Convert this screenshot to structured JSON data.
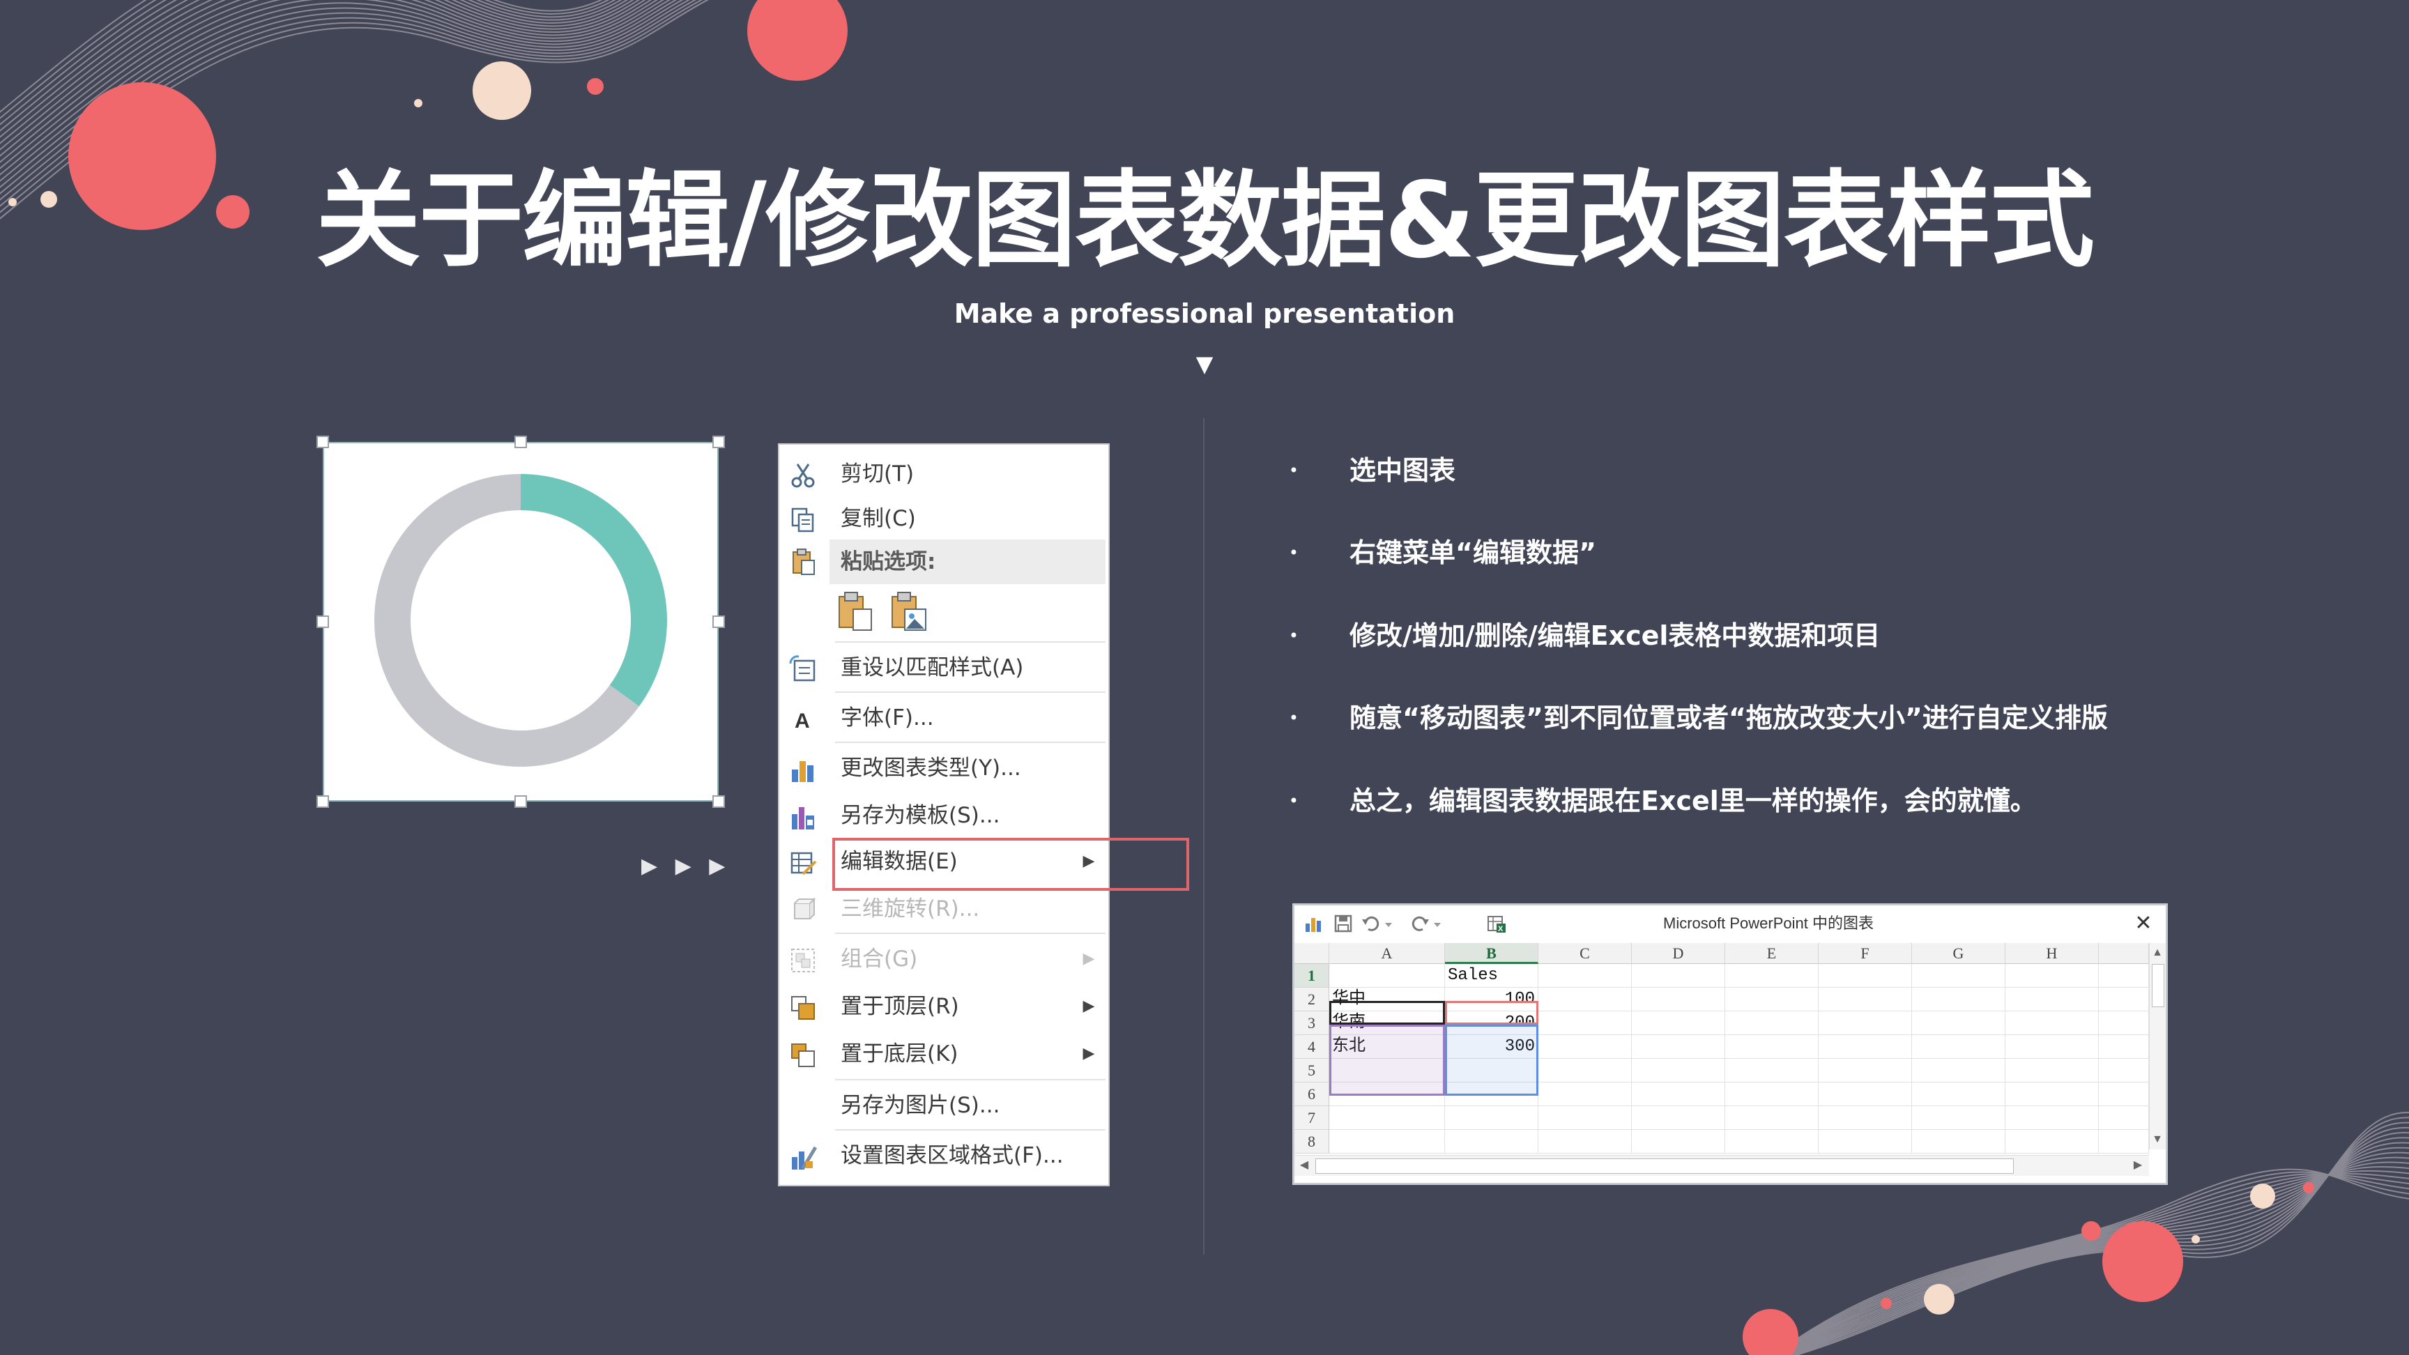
{
  "slide": {
    "title": "关于编辑/修改图表数据&更改图表样式",
    "subtitle": "Make a professional presentation",
    "subtitle_marker": "▼",
    "play_arrows": "▶ ▶ ▶",
    "colors": {
      "background": "#414556",
      "accent_coral": "#F0686B",
      "accent_cream": "#F6DCCB",
      "teal": "#6EC6BB",
      "gray": "#C6C7CD",
      "highlight": "#E0656B"
    }
  },
  "donut_chart": {
    "type": "pie",
    "values": [
      0.35,
      0.65
    ],
    "colors": [
      "#6EC6BB",
      "#C6C7CD"
    ]
  },
  "context_menu": {
    "items": [
      {
        "label": "剪切(T)",
        "icon": "scissors-icon",
        "disabled": false,
        "submenu": false
      },
      {
        "label": "复制(C)",
        "icon": "copy-icon",
        "disabled": false,
        "submenu": false
      },
      {
        "label": "粘贴选项:",
        "icon": "paste-icon",
        "disabled": false,
        "submenu": false
      },
      {
        "label": "重设以匹配样式(A)",
        "icon": "reset-style-icon",
        "disabled": false,
        "submenu": false
      },
      {
        "label": "字体(F)...",
        "icon": "font-icon",
        "disabled": false,
        "submenu": false
      },
      {
        "label": "更改图表类型(Y)...",
        "icon": "chart-type-icon",
        "disabled": false,
        "submenu": false
      },
      {
        "label": "另存为模板(S)...",
        "icon": "save-template-icon",
        "disabled": false,
        "submenu": false
      },
      {
        "label": "编辑数据(E)",
        "icon": "edit-data-icon",
        "disabled": false,
        "submenu": true
      },
      {
        "label": "三维旋转(R)...",
        "icon": "rotate-3d-icon",
        "disabled": true,
        "submenu": false
      },
      {
        "label": "组合(G)",
        "icon": "group-icon",
        "disabled": true,
        "submenu": true
      },
      {
        "label": "置于顶层(R)",
        "icon": "bring-front-icon",
        "disabled": false,
        "submenu": true
      },
      {
        "label": "置于底层(K)",
        "icon": "send-back-icon",
        "disabled": false,
        "submenu": true
      },
      {
        "label": "另存为图片(S)...",
        "icon": "",
        "disabled": false,
        "submenu": false
      },
      {
        "label": "设置图表区域格式(F)...",
        "icon": "format-chart-icon",
        "disabled": false,
        "submenu": false
      }
    ],
    "submenu_arrow": "▶"
  },
  "bullets": {
    "marker": "•",
    "items": [
      "选中图表",
      "右键菜单“编辑数据”",
      "修改/增加/删除/编辑Excel表格中数据和项目",
      "随意“移动图表”到不同位置或者“拖放改变大小”进行自定义排版",
      "总之，编辑图表数据跟在Excel里一样的操作，会的就懂。"
    ]
  },
  "excel": {
    "title": "Microsoft PowerPoint 中的图表",
    "close": "✕",
    "columns": [
      "A",
      "B",
      "C",
      "D",
      "E",
      "F",
      "G",
      "H"
    ],
    "rows": [
      "1",
      "2",
      "3",
      "4",
      "5",
      "6",
      "7",
      "8"
    ],
    "cells": {
      "B1": "Sales",
      "A2": "华中",
      "B2": "100",
      "A3": "华南",
      "B3": "200",
      "A4": "东北",
      "B4": "300"
    },
    "scroll_up": "▲",
    "scroll_down": "▼",
    "scroll_left": "◀",
    "scroll_right": "▶"
  }
}
